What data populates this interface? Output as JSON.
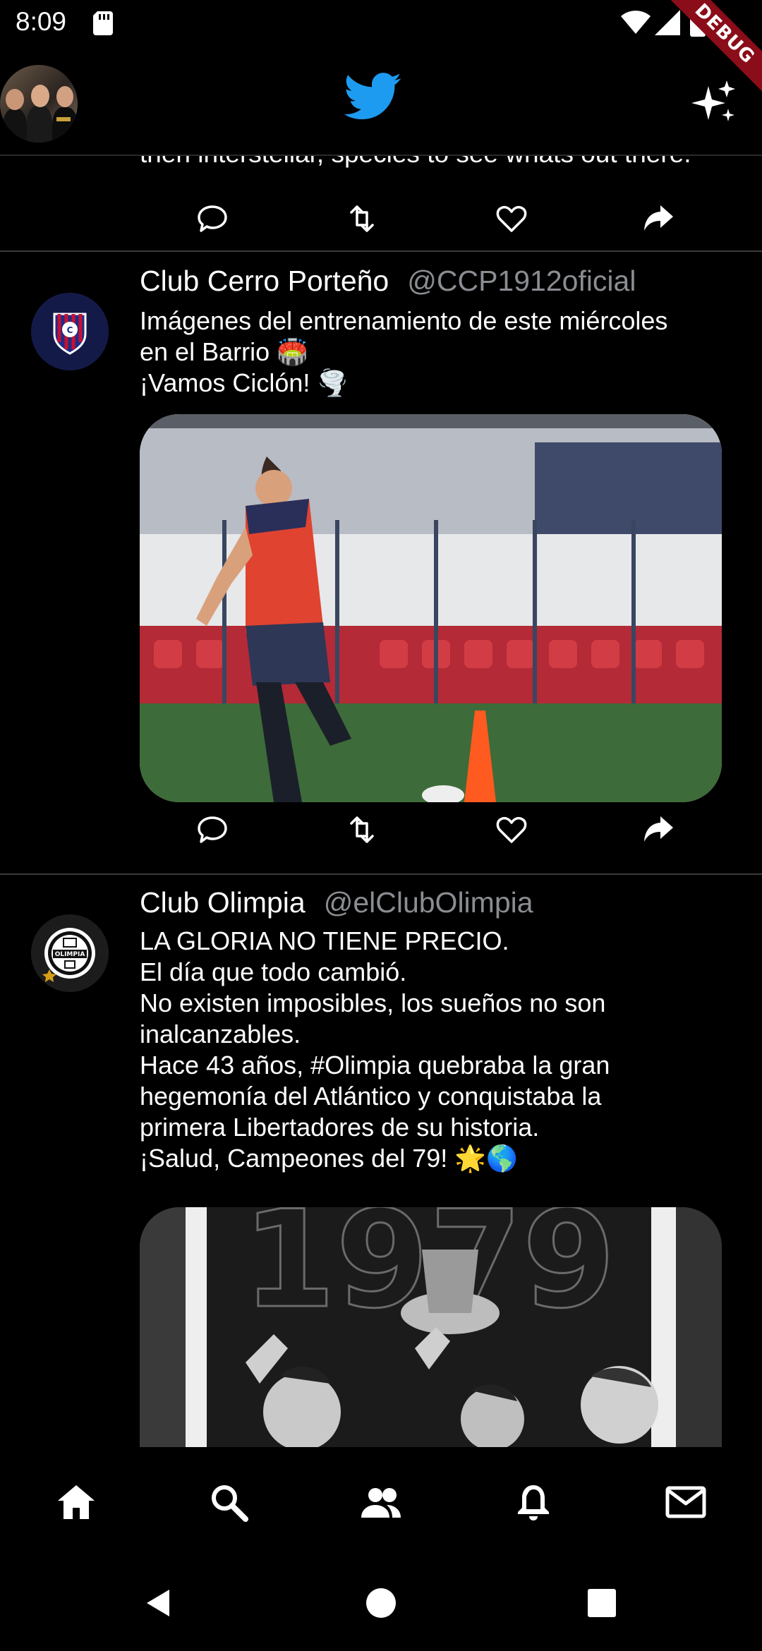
{
  "status_bar": {
    "time": "8:09"
  },
  "debug_banner": "DEBUG",
  "app_bar": {
    "logo_icon": "twitter-bird-icon",
    "right_icon": "sparkle-icon"
  },
  "previous_tweet": {
    "partial_text": "then interstellar, species to see whats out there."
  },
  "tweets": [
    {
      "name": "Club Cerro Porteño",
      "handle": "@CCP1912oficial",
      "lines": [
        "Imágenes del entrenamiento de este miércoles",
        "en el Barrio 🏟️",
        " ¡Vamos Ciclón! 🌪️"
      ]
    },
    {
      "name": "Club Olimpia",
      "handle": "@elClubOlimpia",
      "lines": [
        "LA GLORIA NO TIENE PRECIO.",
        "El día que todo cambió.",
        "No existen imposibles, los sueños no son",
        "inalcanzables.",
        "Hace 43 años, #Olimpia quebraba la gran",
        "hegemonía del Atlántico y conquistaba la",
        "primera Libertadores de su historia.",
        "¡Salud, Campeones del 79! 🌟🌎"
      ],
      "image_text": "1979"
    }
  ],
  "tweet_actions": [
    "reply-icon",
    "retweet-icon",
    "like-icon",
    "share-icon"
  ],
  "bottom_nav": [
    "home-icon",
    "search-icon",
    "communities-icon",
    "notifications-icon",
    "messages-icon"
  ],
  "system_nav": [
    "back-icon",
    "home-circle-icon",
    "recents-icon"
  ],
  "colors": {
    "background": "#000000",
    "text": "#ffffff",
    "handle": "#8a8d91",
    "accent": "#1d9bf0",
    "divider": "#3a3a3a"
  }
}
